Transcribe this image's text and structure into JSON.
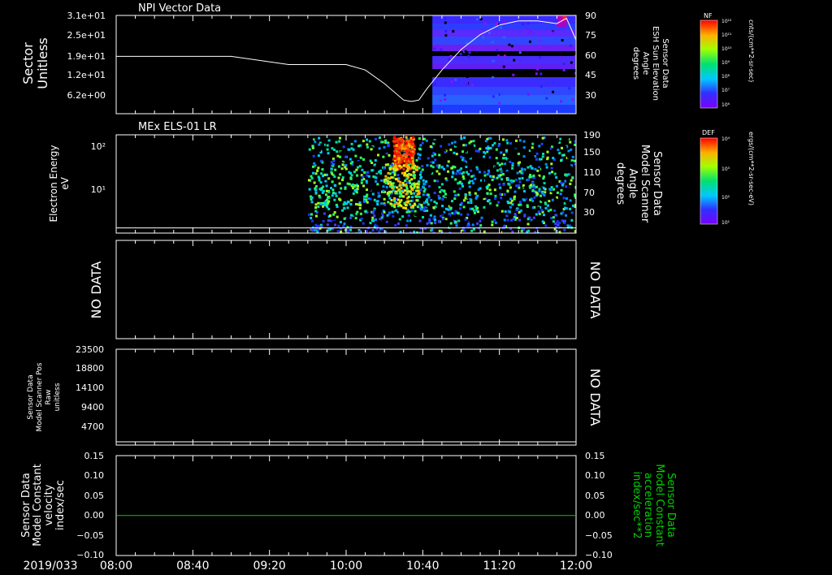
{
  "date_label": "2019/033",
  "time_axis": {
    "start": "08:00",
    "end": "12:00",
    "tick_labels": [
      "08:00",
      "08:40",
      "09:20",
      "10:00",
      "10:40",
      "11:20",
      "12:00"
    ]
  },
  "colors": {
    "axis": "#ffffff",
    "green_trace": "#00d000",
    "background": "#000000"
  },
  "colorbars": [
    {
      "label": "NF",
      "unit": "cnts/(cm**2-sr-sec)",
      "ticks": [
        "10¹²",
        "10¹¹",
        "10¹⁰",
        "10⁹",
        "10⁸",
        "10⁷",
        "10⁶"
      ]
    },
    {
      "label": "DEF",
      "unit": "ergs/(cm**2-sr-sec-eV)",
      "ticks": [
        "10⁴",
        "10³",
        "10²",
        "10¹"
      ]
    }
  ],
  "chart_data": [
    {
      "type": "heatmap",
      "title": "NPI Vector Data",
      "ylabel": [
        "Sector",
        "Unitless"
      ],
      "y_tick_labels": [
        "3.1e+01",
        "2.5e+01",
        "1.9e+01",
        "1.2e+01",
        "6.2e+00"
      ],
      "right_ylabel": [
        "Sensor Data",
        "ESH Sun Elevation",
        "Angle",
        "degrees"
      ],
      "right_y_tick_labels": [
        "90",
        "75",
        "60",
        "45",
        "30"
      ],
      "right_ylim": [
        18,
        90
      ],
      "heatmap_time_range": [
        "10:45",
        "12:00"
      ],
      "line_series": {
        "name": "ESH Sun Elevation Angle",
        "x": [
          "08:00",
          "09:00",
          "09:30",
          "10:00",
          "10:10",
          "10:20",
          "10:30",
          "10:34",
          "10:38",
          "10:42",
          "10:50",
          "11:00",
          "11:10",
          "11:20",
          "11:30",
          "11:40",
          "11:50",
          "11:55",
          "12:00"
        ],
        "y": [
          60,
          60,
          54,
          54,
          50,
          40,
          28,
          27,
          28,
          36,
          50,
          65,
          76,
          83,
          86,
          86,
          84,
          88,
          72
        ]
      }
    },
    {
      "type": "heatmap",
      "title": "MEx ELS-01 LR",
      "ylabel": [
        "Electron Energy",
        "eV"
      ],
      "y_tick_labels": [
        "10²",
        "10¹"
      ],
      "right_ylabel": [
        "Sensor Data",
        "Model Scanner",
        "Angle",
        "degrees"
      ],
      "right_y_tick_labels": [
        "190",
        "150",
        "110",
        "70",
        "30"
      ],
      "right_ylim": [
        0,
        190
      ],
      "line_series": {
        "name": "Model Scanner Angle",
        "x": [
          "08:00",
          "12:00"
        ],
        "y": [
          10,
          10
        ]
      },
      "data_time_range": [
        "09:40",
        "12:00"
      ]
    },
    {
      "type": "line",
      "ylabel": [
        "NO DATA"
      ],
      "right_ylabel": [
        "NO DATA"
      ]
    },
    {
      "type": "line",
      "ylabel": [
        "Sensor Data",
        "Model Scanner Pos",
        "Raw",
        "unitless"
      ],
      "y_tick_labels": [
        "23500",
        "18800",
        "14100",
        "9400",
        "4700"
      ],
      "right_ylabel": [
        "NO DATA"
      ],
      "ylim": [
        0,
        23500
      ],
      "series": [
        {
          "x": [
            "08:00",
            "12:00"
          ],
          "values": [
            0,
            0
          ]
        }
      ]
    },
    {
      "type": "line",
      "ylabel": [
        "Sensor Data",
        "Model Constant",
        "velocity",
        "index/sec"
      ],
      "y_tick_labels": [
        "0.15",
        "0.10",
        "0.05",
        "0.00",
        "−0.05",
        "−0.10"
      ],
      "right_ylabel": [
        "Sensor Data",
        "Model Constant",
        "acceleration",
        "index/sec**2"
      ],
      "right_y_tick_labels": [
        "0.15",
        "0.10",
        "0.05",
        "0.00",
        "−0.05",
        "−0.10"
      ],
      "ylim": [
        -0.1,
        0.15
      ],
      "series": [
        {
          "x": [
            "08:00",
            "12:00"
          ],
          "values": [
            0.0,
            0.0
          ]
        }
      ]
    }
  ]
}
